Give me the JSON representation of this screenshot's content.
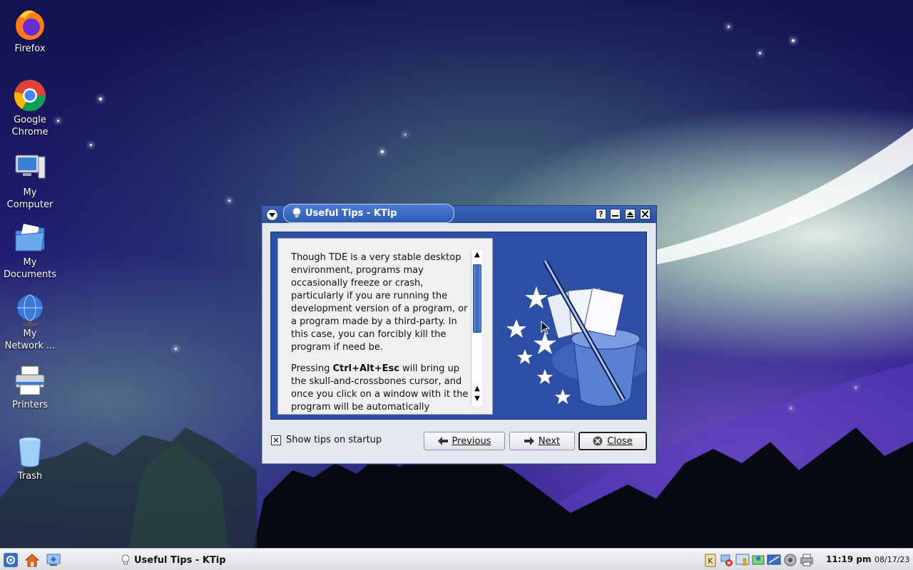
{
  "desktop": {
    "icons": [
      {
        "label": "Firefox",
        "icon": "firefox-icon"
      },
      {
        "label": "Google\nChrome",
        "icon": "chrome-icon"
      },
      {
        "label": "My\nComputer",
        "icon": "computer-icon"
      },
      {
        "label": "My\nDocuments",
        "icon": "folder-icon"
      },
      {
        "label": "My\nNetwork ...",
        "icon": "network-icon"
      },
      {
        "label": "Printers",
        "icon": "printer-icon"
      },
      {
        "label": "Trash",
        "icon": "trash-icon"
      }
    ]
  },
  "window": {
    "title": "Useful Tips - KTip",
    "tip_paragraph_1": "Though TDE is a very stable desktop environment, programs may occasionally freeze or crash, particularly if you are running the development version of a program, or a program made by a third-party. In this case, you can forcibly kill the program if need be.",
    "tip_paragraph_2_pre": "Pressing ",
    "tip_paragraph_2_bold": "Ctrl+Alt+Esc",
    "tip_paragraph_2_post": " will bring up the skull-and-crossbones cursor, and once you click on a window with it the program will be automatically",
    "show_tips_label": "Show tips on startup",
    "show_tips_checked": true,
    "previous_label": "Previous",
    "next_label": "Next",
    "close_label": "Close"
  },
  "taskbar": {
    "task_label": "Useful Tips - KTip",
    "time": "11:19 pm",
    "date": "08/17/23"
  },
  "colors": {
    "titlebar": "#2a4f9d",
    "tip_frame": "#2e4fa6",
    "window_bg": "#e4e7ee"
  }
}
